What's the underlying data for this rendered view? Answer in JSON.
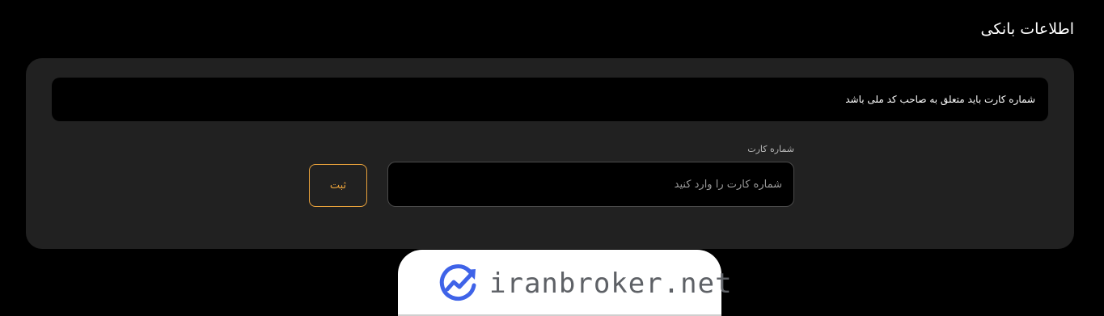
{
  "section": {
    "title": "اطلاعات بانکی"
  },
  "notice": {
    "text": "شماره کارت باید متعلق به صاحب کد ملی باشد"
  },
  "form": {
    "card_label": "شماره کارت",
    "card_placeholder": "شماره کارت را وارد کنید",
    "card_value": "",
    "submit_label": "ثبت"
  },
  "watermark": {
    "text": "iranbroker.net",
    "logo_icon": "chart-trend-logo-icon"
  },
  "colors": {
    "background": "#000000",
    "card": "#212121",
    "accent": "#e9a23b",
    "logo_blue": "#3f63e8",
    "watermark_text": "#5e6166"
  }
}
